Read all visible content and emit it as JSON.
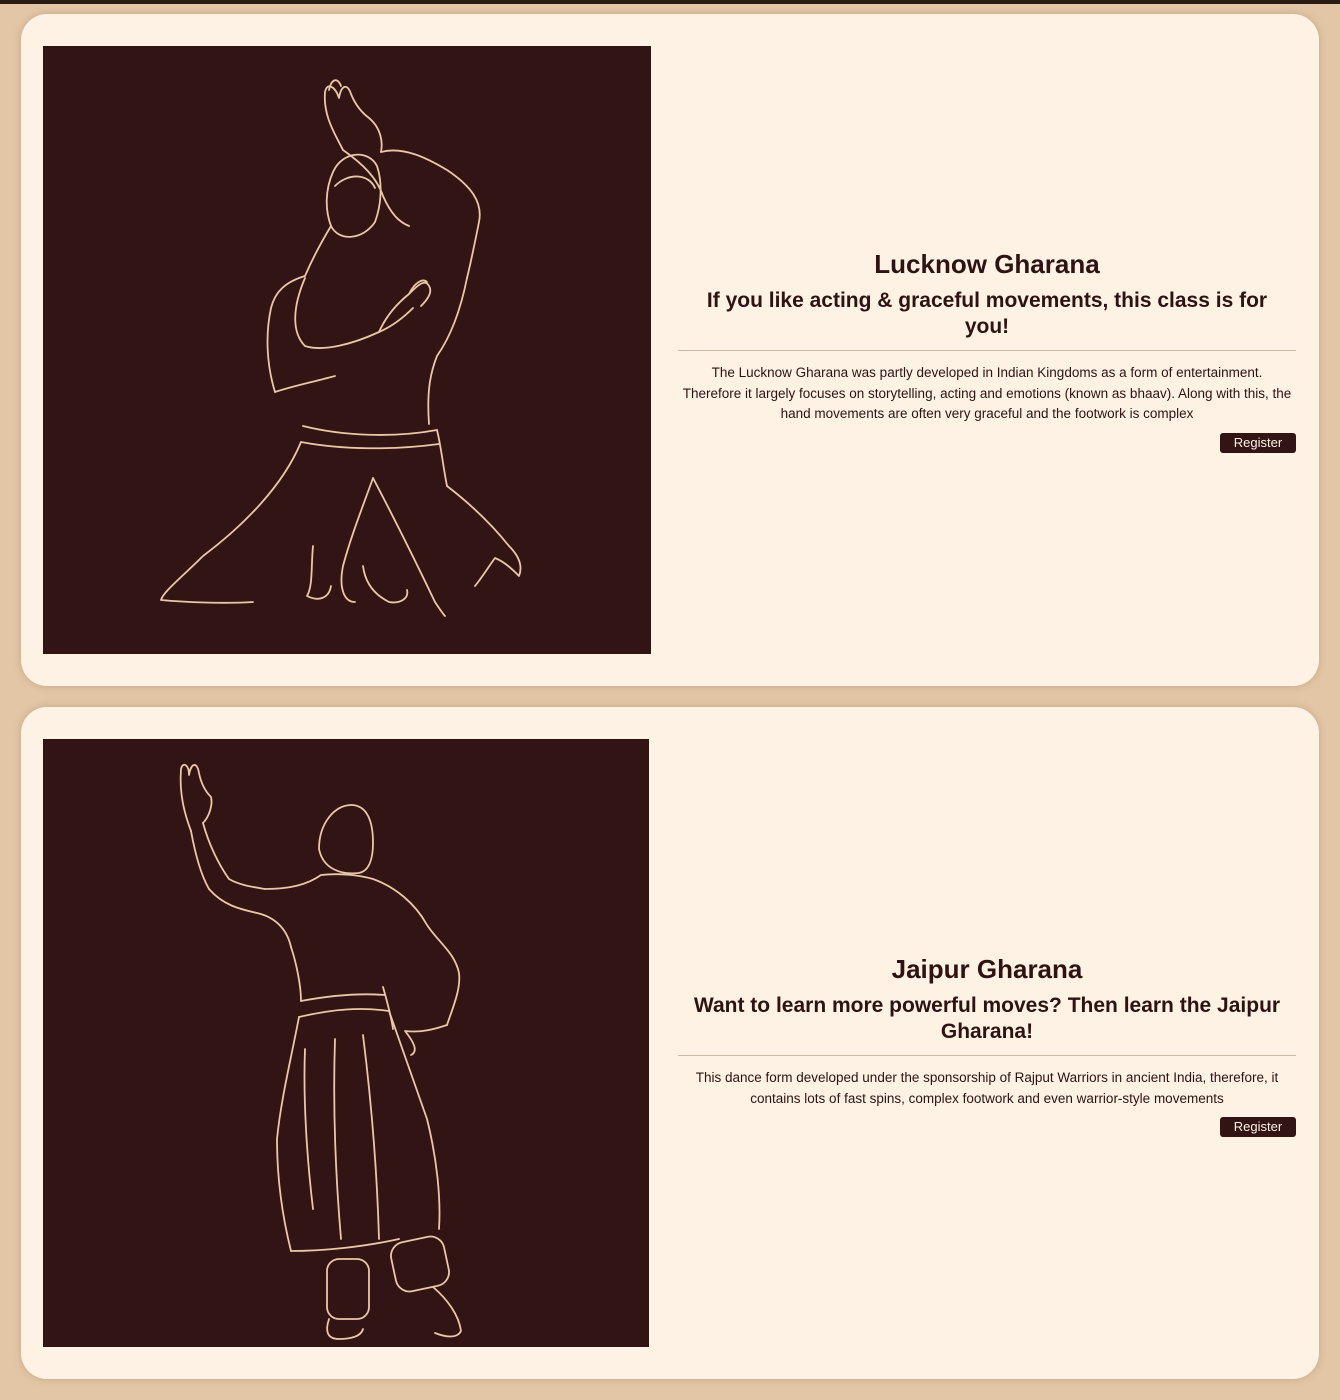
{
  "classes": [
    {
      "title": "Lucknow Gharana",
      "subtitle": "If you like acting & graceful movements, this class is for you!",
      "description": "The Lucknow Gharana was partly developed in Indian Kingdoms as a form of entertainment. Therefore it largely focuses on storytelling, acting and emotions (known as bhaav). Along with this, the hand movements are often very graceful and the footwork is complex",
      "button_label": "Register",
      "illustration": "kneeling-dancer-line-art"
    },
    {
      "title": "Jaipur Gharana",
      "subtitle": "Want to learn more powerful moves? Then learn the Jaipur Gharana!",
      "description": "This dance form developed under the sponsorship of Rajput Warriors in ancient India, therefore, it contains lots of fast spins, complex footwork and even warrior-style movements",
      "button_label": "Register",
      "illustration": "standing-dancer-line-art"
    }
  ],
  "colors": {
    "page_background": "#e2c6a6",
    "card_background": "#fdf2e4",
    "accent_dark": "#331414",
    "line_art": "#e9c9a5",
    "text": "#2f1212"
  }
}
